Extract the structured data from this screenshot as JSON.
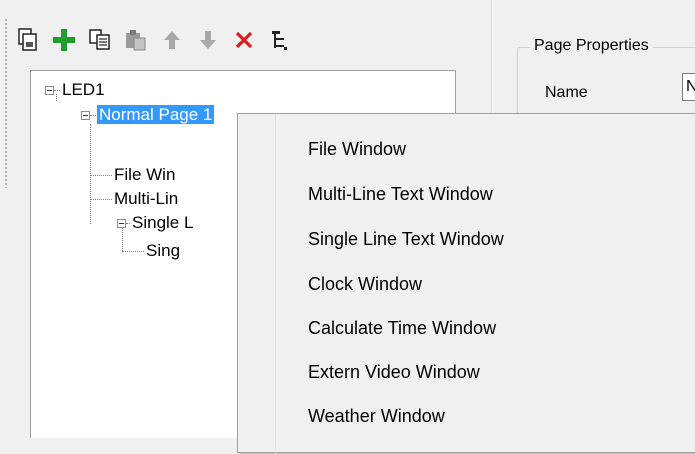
{
  "toolbar": {
    "items": [
      {
        "icon": "new-program-icon"
      },
      {
        "icon": "add-icon",
        "color": "#1f9e2d"
      },
      {
        "icon": "copy-icon"
      },
      {
        "icon": "paste-icon"
      },
      {
        "icon": "move-up-icon"
      },
      {
        "icon": "move-down-icon"
      },
      {
        "icon": "delete-icon",
        "color": "#e01b1b"
      },
      {
        "icon": "tree-structure-icon"
      }
    ]
  },
  "tree": {
    "root": "LED1",
    "page": "Normal Page 1",
    "children": [
      "File Win",
      "Multi-Lin",
      "Single L"
    ],
    "grandchild": "Sing"
  },
  "properties": {
    "group_title": "Page Properties",
    "name_label": "Name",
    "name_value": "N"
  },
  "context_menu": {
    "items": [
      "File Window",
      "Multi-Line Text Window",
      "Single Line Text Window",
      "Clock Window",
      "Calculate Time Window",
      "Extern Video Window",
      "Weather Window"
    ]
  },
  "colors": {
    "selection": "#3399ff",
    "add": "#1f9e2d",
    "delete": "#e01b1b"
  }
}
